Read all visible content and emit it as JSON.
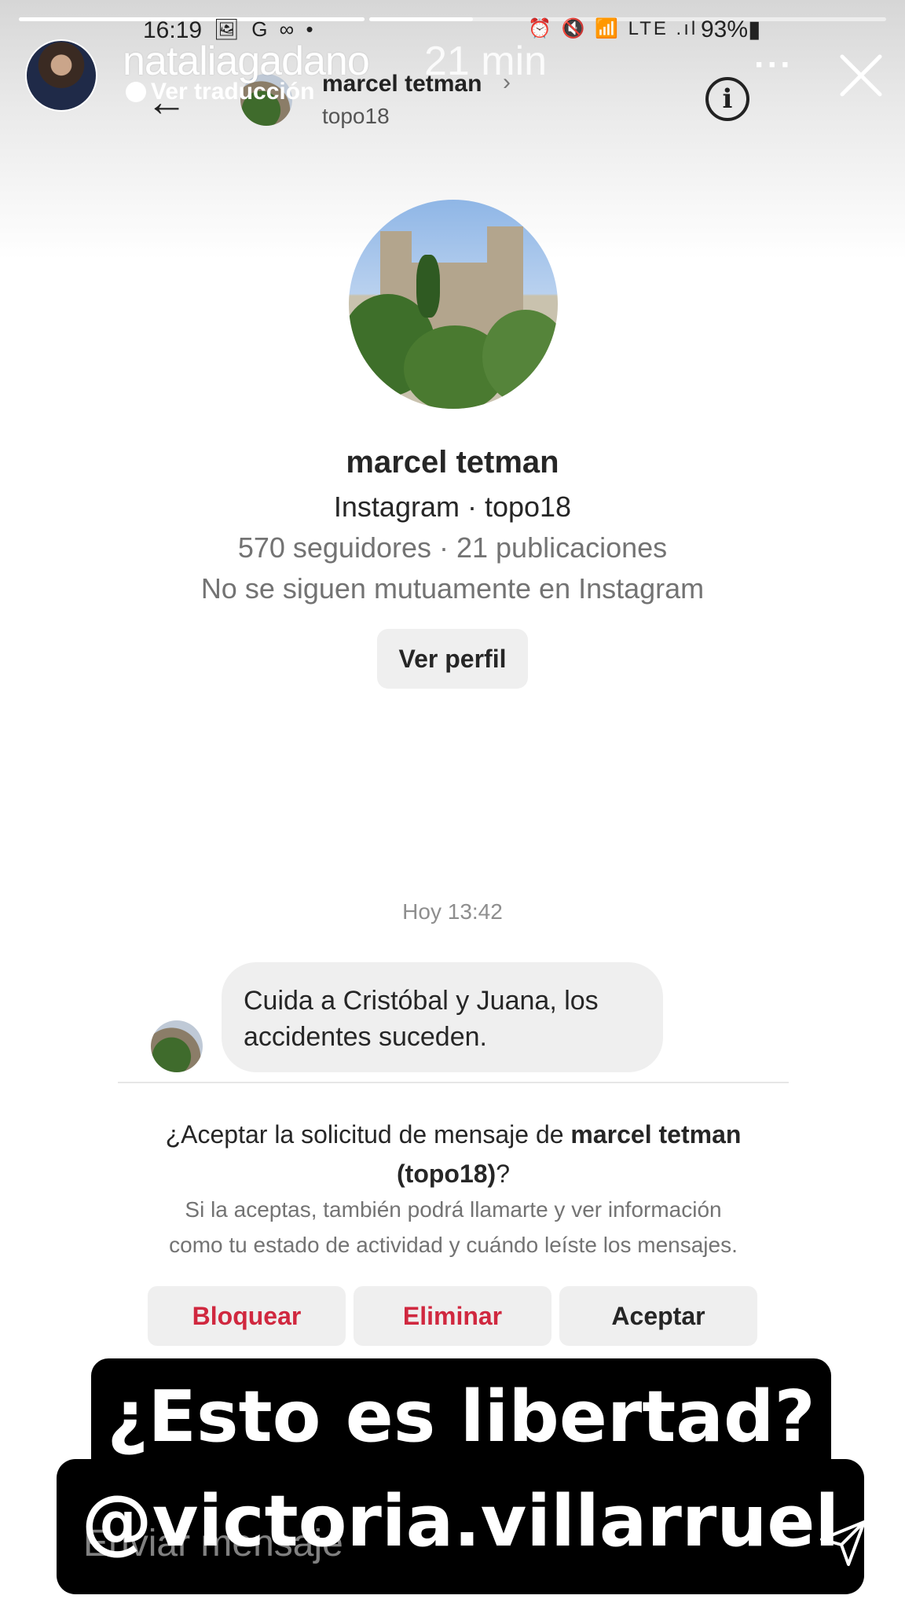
{
  "status_bar": {
    "time": "16:19",
    "left_icons": "🖼 G ∞ •",
    "right_icons": "⏰ 🔇 📶 LTE .ıl",
    "battery": "93%▮"
  },
  "story": {
    "username": "nataliagadano",
    "time_ago": "21 min",
    "translate_label": "Ver traducción",
    "more_label": "···",
    "progress": [
      1.0,
      0.2
    ],
    "reply_placeholder": "Enviar mensaje",
    "captions": [
      "¿Esto es libertad?",
      "@victoria.villarruel"
    ]
  },
  "dm_header": {
    "back_icon": "←",
    "name": "marcel tetman",
    "chevron": "›",
    "handle": "topo18",
    "info_icon": "i"
  },
  "profile": {
    "name": "marcel tetman",
    "subtitle": "Instagram · topo18",
    "stats": "570 seguidores · 21 publicaciones",
    "mutual": "No se siguen mutuamente en Instagram",
    "view_profile_label": "Ver perfil"
  },
  "conversation": {
    "timestamp": "Hoy 13:42",
    "message_line1": "Cuida a Cristóbal y Juana, los",
    "message_line2": "accidentes suceden."
  },
  "request": {
    "title_prefix": "¿Aceptar la solicitud de mensaje de ",
    "title_name": "marcel tetman",
    "title_handle": "(topo18)",
    "title_suffix": "?",
    "desc_line1": "Si la aceptas, también podrá llamarte y ver información",
    "desc_line2": "como tu estado de actividad y cuándo leíste los mensajes.",
    "block_label": "Bloquear",
    "delete_label": "Eliminar",
    "accept_label": "Aceptar"
  },
  "colors": {
    "destructive": "#d0283f",
    "button_bg": "#efefef",
    "secondary_text": "#737373",
    "caption_bg": "#000000"
  }
}
